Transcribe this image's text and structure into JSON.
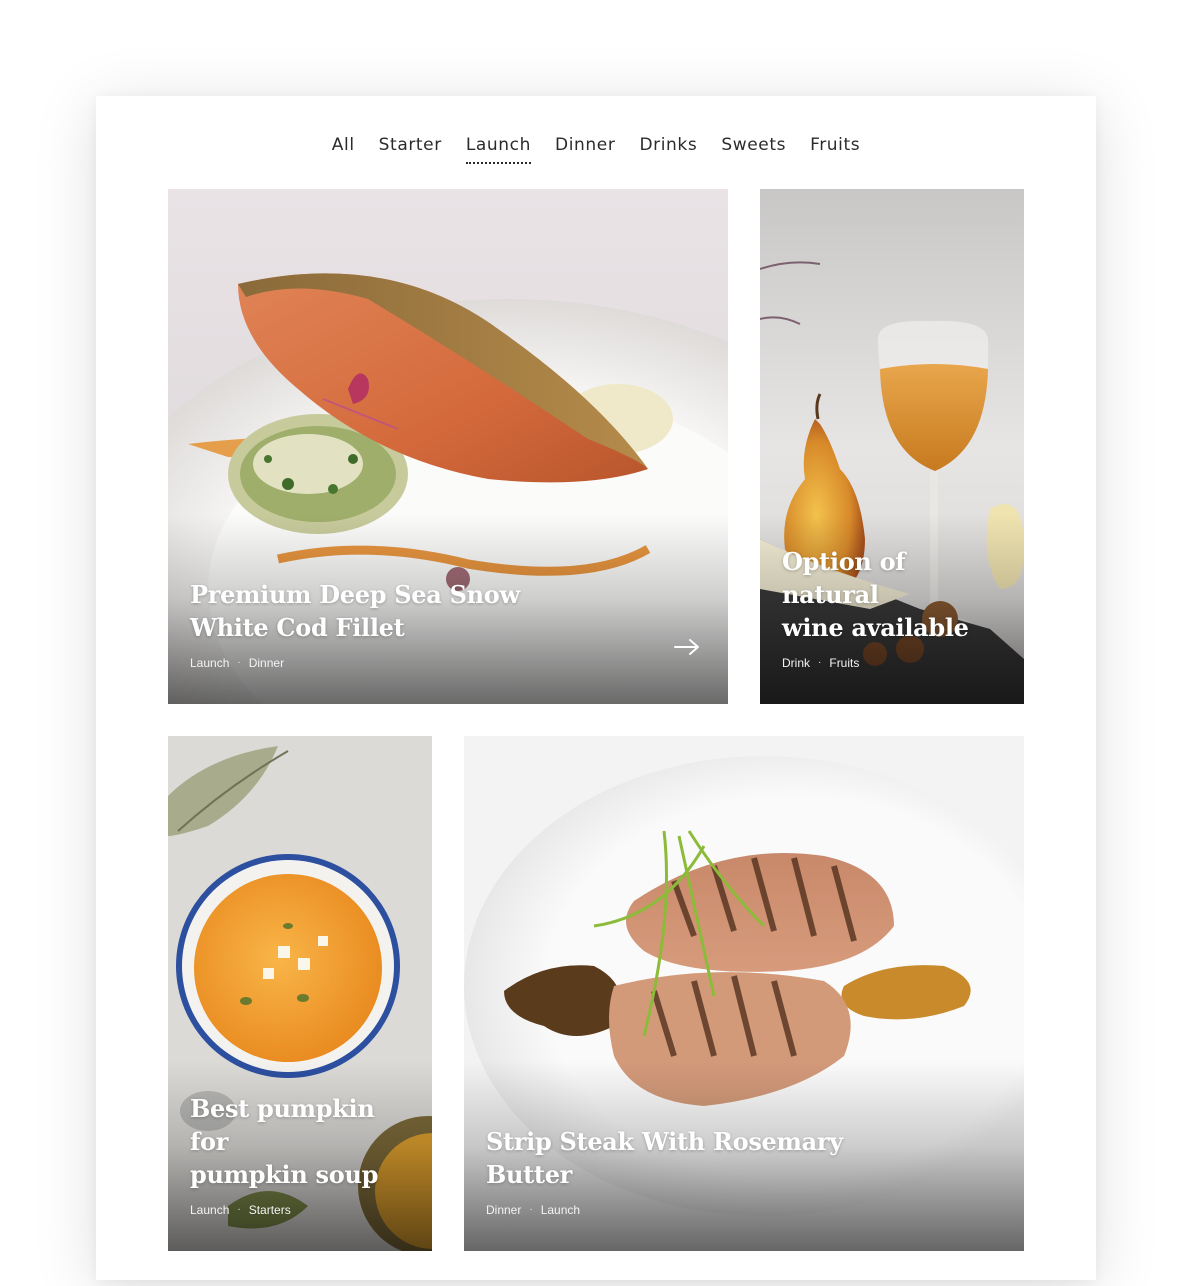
{
  "filters": {
    "items": [
      {
        "label": "All",
        "active": false
      },
      {
        "label": "Starter",
        "active": false
      },
      {
        "label": "Launch",
        "active": true
      },
      {
        "label": "Dinner",
        "active": false
      },
      {
        "label": "Drinks",
        "active": false
      },
      {
        "label": "Sweets",
        "active": false
      },
      {
        "label": "Fruits",
        "active": false
      }
    ]
  },
  "cards": [
    {
      "title_line1": "Premium Deep Sea Snow",
      "title_line2": "White Cod Fillet",
      "tag1": "Launch",
      "tag2": "Dinner",
      "separator": "·",
      "arrow_icon": "arrow-right-icon"
    },
    {
      "title_line1": "Option of natural",
      "title_line2": "wine available",
      "tag1": "Drink",
      "tag2": "Fruits",
      "separator": "·"
    },
    {
      "title_line1": "Best pumpkin for",
      "title_line2": "pumpkin soup",
      "tag1": "Launch",
      "tag2": "Starters",
      "separator": "·"
    },
    {
      "title_line1": "Strip Steak With Rosemary",
      "title_line2": "Butter",
      "tag1": "Dinner",
      "tag2": "Launch",
      "separator": "·"
    }
  ],
  "colors": {
    "text": "#2b2b2b",
    "caption": "#ffffff"
  }
}
